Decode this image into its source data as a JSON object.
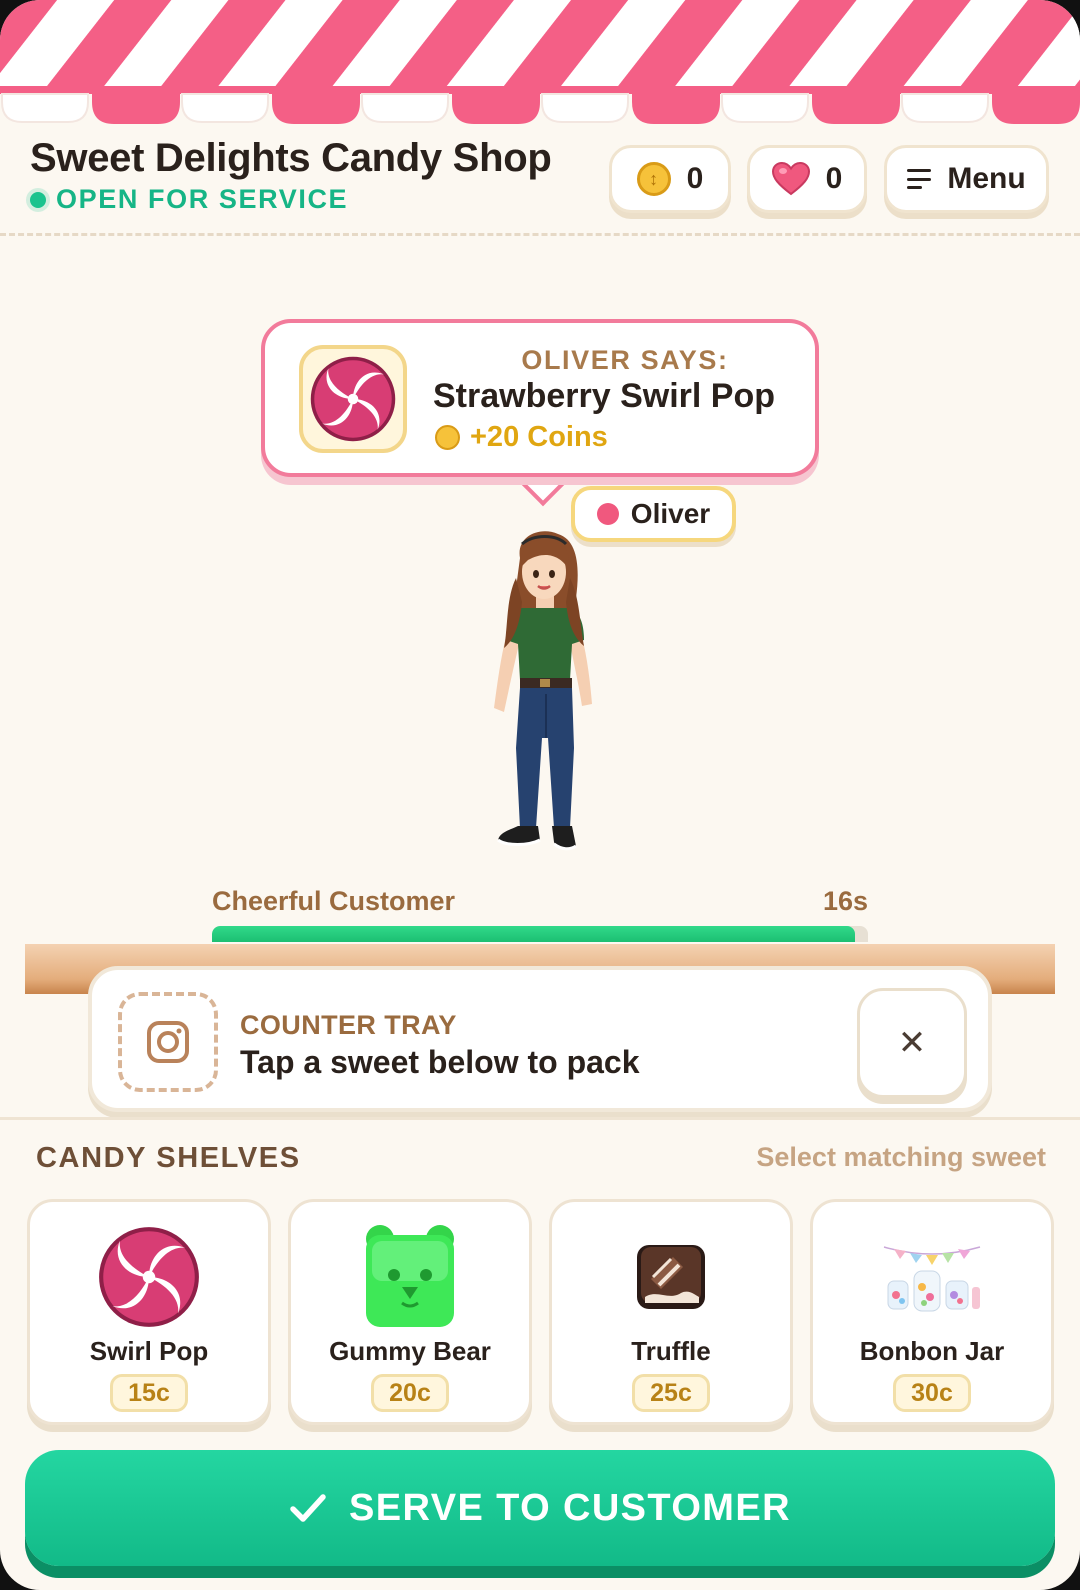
{
  "header": {
    "shop_title": "Sweet Delights Candy Shop",
    "status": "OPEN FOR SERVICE",
    "coins": "0",
    "hearts": "0",
    "menu_label": "Menu"
  },
  "order": {
    "speaker_line": "OLIVER SAYS:",
    "item_name": "Strawberry Swirl Pop",
    "reward": "+20 Coins",
    "icon": "swirl-lollipop-icon"
  },
  "customer": {
    "name": "Oliver",
    "mood_label": "Cheerful Customer",
    "timer": "16s",
    "patience_fraction": 0.98
  },
  "tray": {
    "title": "COUNTER TRAY",
    "hint": "Tap a sweet below to pack",
    "slot_icon": "empty-slot-icon",
    "clear_icon": "close-icon"
  },
  "shelves": {
    "title": "CANDY SHELVES",
    "hint": "Select matching sweet",
    "items": [
      {
        "label": "Swirl Pop",
        "price": "15c",
        "icon": "swirl-lollipop-icon"
      },
      {
        "label": "Gummy Bear",
        "price": "20c",
        "icon": "gummy-bear-icon"
      },
      {
        "label": "Truffle",
        "price": "25c",
        "icon": "truffle-icon"
      },
      {
        "label": "Bonbon Jar",
        "price": "30c",
        "icon": "bonbon-jar-icon"
      }
    ]
  },
  "serve_button": {
    "label": "SERVE TO CUSTOMER"
  },
  "colors": {
    "awning_pink": "#f45f86",
    "accent_green": "#16b586",
    "coin_gold": "#f6c23a",
    "heart_pink": "#f0587e",
    "background": "#fcf8f1"
  }
}
